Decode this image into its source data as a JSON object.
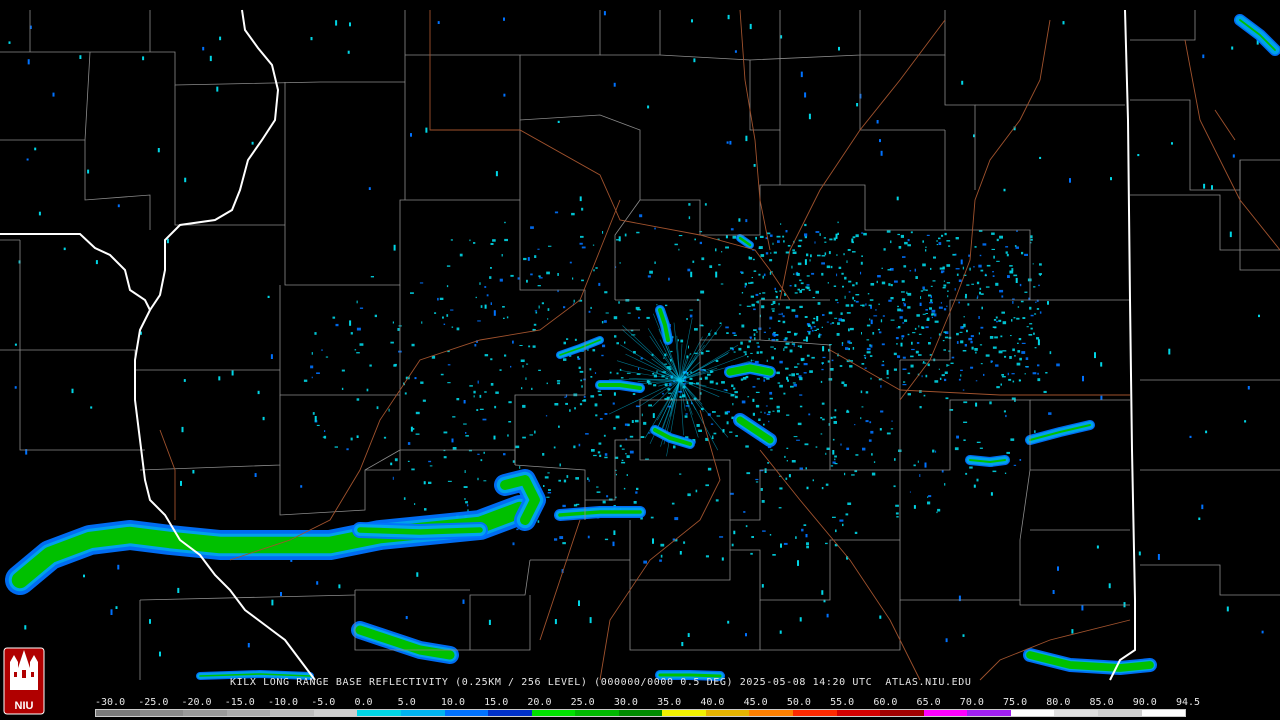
{
  "product_caption": "KILX LONG RANGE BASE REFLECTIVITY (0.25KM / 256 LEVEL) (000000/0000 0.5 DEG) 2025-05-08 14:20 UTC  ATLAS.NIU.EDU",
  "color_scale": {
    "labels": [
      "-30.0",
      "-25.0",
      "-20.0",
      "-15.0",
      "-10.0",
      "-5.0",
      "0.0",
      "5.0",
      "10.0",
      "15.0",
      "20.0",
      "25.0",
      "30.0",
      "35.0",
      "40.0",
      "45.0",
      "50.0",
      "55.0",
      "60.0",
      "65.0",
      "70.0",
      "75.0",
      "80.0",
      "85.0",
      "90.0",
      "94.5"
    ],
    "colors": [
      "#7a7a7a",
      "#8a8a8a",
      "#9a9a9a",
      "#aaaaaa",
      "#bdbdbd",
      "#cfcfcf",
      "#00d6e6",
      "#00b4f0",
      "#0072ff",
      "#0030c8",
      "#00e000",
      "#00b800",
      "#008a00",
      "#f0f000",
      "#e6b400",
      "#ff8000",
      "#ff2a00",
      "#d40000",
      "#a00000",
      "#ff00ff",
      "#a020f0",
      "#ffffff",
      "#e0e0e0",
      "#d0d0d0",
      "#ffffff"
    ]
  },
  "logo": {
    "text": "NIU",
    "icon": "niu-logo-icon"
  },
  "map_colors": {
    "county_lines": "#8c8c8c",
    "state_lines": "#ffffff",
    "roads": "#a0522d",
    "background": "#000000"
  }
}
